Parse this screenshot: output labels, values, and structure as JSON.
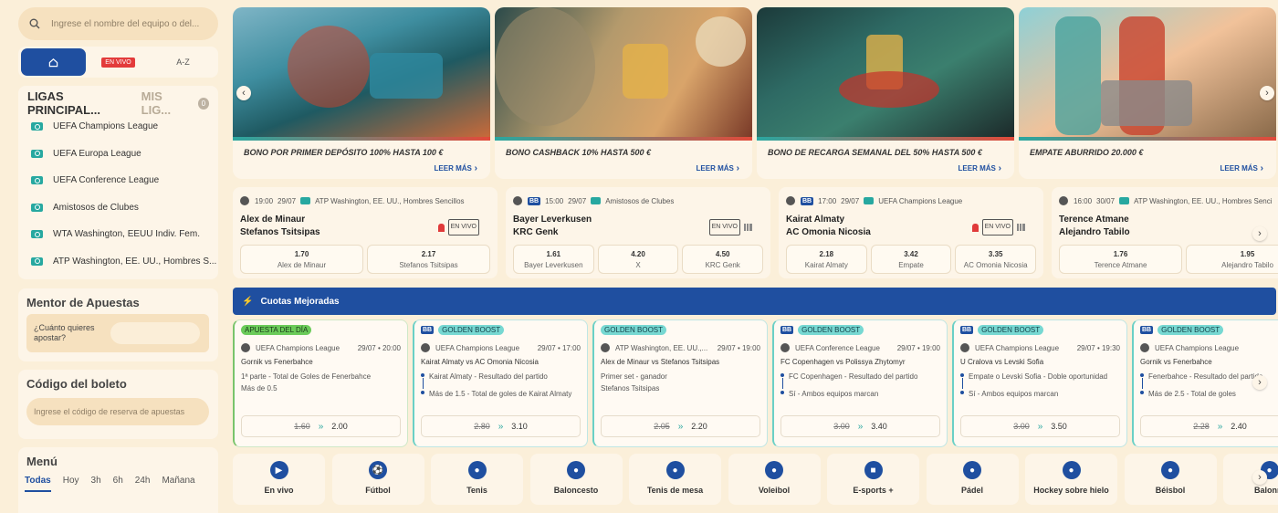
{
  "search": {
    "placeholder": "Ingrese el nombre del equipo o del..."
  },
  "nav": {
    "home_icon": "home-icon",
    "live_label": "EN VIVO",
    "az_label": "A-Z"
  },
  "leagues": {
    "title": "LIGAS PRINCIPAL...",
    "mine": "MIS LIG...",
    "mine_count": "0",
    "items": [
      "UEFA Champions League",
      "UEFA Europa League",
      "UEFA Conference League",
      "Amistosos de Clubes",
      "WTA Washington, EEUU Indiv. Fem.",
      "ATP Washington, EE. UU., Hombres S..."
    ]
  },
  "mentor": {
    "title": "Mentor de Apuestas",
    "question": "¿Cuánto quieres apostar?"
  },
  "ticket": {
    "title": "Código del boleto",
    "placeholder": "Ingrese el código de reserva de apuestas"
  },
  "menu": {
    "title": "Menú",
    "tabs": [
      "Todas",
      "Hoy",
      "3h",
      "6h",
      "24h",
      "Mañana"
    ]
  },
  "promos": [
    {
      "title": "BONO POR PRIMER DEPÓSITO 100% HASTA 100 €",
      "more": "LEER MÁS"
    },
    {
      "title": "BONO CASHBACK 10% HASTA 500 €",
      "more": "LEER MÁS"
    },
    {
      "title": "BONO DE RECARGA SEMANAL DEL 50% HASTA 500 €",
      "more": "LEER MÁS"
    },
    {
      "title": "EMPATE ABURRIDO 20.000 €",
      "more": "LEER MÁS"
    }
  ],
  "matches": [
    {
      "time": "19:00",
      "date": "29/07",
      "league": "ATP Washington, EE. UU., Hombres Sencillos",
      "team1": "Alex de Minaur",
      "team2": "Stefanos Tsitsipas",
      "live": "EN VIVO",
      "odds": [
        {
          "v": "1.70",
          "l": "Alex de Minaur"
        },
        {
          "v": "2.17",
          "l": "Stefanos Tsitsipas"
        }
      ]
    },
    {
      "bb": "BB",
      "time": "15:00",
      "date": "29/07",
      "league": "Amistosos de Clubes",
      "team1": "Bayer Leverkusen",
      "team2": "KRC Genk",
      "live": "EN VIVO",
      "odds": [
        {
          "v": "1.61",
          "l": "Bayer Leverkusen"
        },
        {
          "v": "4.20",
          "l": "X"
        },
        {
          "v": "4.50",
          "l": "KRC Genk"
        }
      ]
    },
    {
      "bb": "BB",
      "time": "17:00",
      "date": "29/07",
      "league": "UEFA Champions League",
      "team1": "Kairat Almaty",
      "team2": "AC Omonia Nicosia",
      "live": "EN VIVO",
      "odds": [
        {
          "v": "2.18",
          "l": "Kairat Almaty"
        },
        {
          "v": "3.42",
          "l": "Empate"
        },
        {
          "v": "3.35",
          "l": "AC Omonia Nicosia"
        }
      ]
    },
    {
      "time": "16:00",
      "date": "30/07",
      "league": "ATP Washington, EE. UU., Hombres Senci",
      "team1": "Terence Atmane",
      "team2": "Alejandro Tabilo",
      "odds": [
        {
          "v": "1.76",
          "l": "Terence Atmane"
        },
        {
          "v": "1.95",
          "l": "Alejandro Tabilo"
        }
      ]
    }
  ],
  "boost_title": "Cuotas Mejoradas",
  "boosts": [
    {
      "tag": "APUESTA DEL DÍA",
      "league": "UEFA Champions League",
      "date": "29/07 • 20:00",
      "match": "Gornik vs Fenerbahce",
      "lines": [
        "1ª parte - Total de Goles de Fenerbahce",
        "Más de 0.5"
      ],
      "old": "1.60",
      "new": "2.00"
    },
    {
      "bb": "BB",
      "tag": "GOLDEN BOOST",
      "league": "UEFA Champions League",
      "date": "29/07 • 17:00",
      "match": "Kairat Almaty vs AC Omonia Nicosia",
      "sels": [
        "Kairat Almaty - Resultado del partido",
        "Más de 1.5 - Total de goles de Kairat Almaty"
      ],
      "old": "2.80",
      "new": "3.10"
    },
    {
      "tag": "GOLDEN BOOST",
      "league": "ATP Washington, EE. UU.,...",
      "date": "29/07 • 19:00",
      "match": "Alex de Minaur vs Stefanos Tsitsipas",
      "lines": [
        "Primer set - ganador",
        "Stefanos Tsitsipas"
      ],
      "old": "2.05",
      "new": "2.20"
    },
    {
      "bb": "BB",
      "tag": "GOLDEN BOOST",
      "league": "UEFA Conference League",
      "date": "29/07 • 19:00",
      "match": "FC Copenhagen vs Polissya Zhytomyr",
      "sels": [
        "FC Copenhagen - Resultado del partido",
        "Sí - Ambos equipos marcan"
      ],
      "old": "3.00",
      "new": "3.40"
    },
    {
      "bb": "BB",
      "tag": "GOLDEN BOOST",
      "league": "UEFA Champions League",
      "date": "29/07 • 19:30",
      "match": "U Cralova vs Levski Sofia",
      "sels": [
        "Empate o Levski Sofia - Doble oportunidad",
        "Sí - Ambos equipos marcan"
      ],
      "old": "3.00",
      "new": "3.50"
    },
    {
      "bb": "BB",
      "tag": "GOLDEN BOOST",
      "league": "UEFA Champions League",
      "date": "29/07",
      "match": "Gornik vs Fenerbahce",
      "sels": [
        "Fenerbahce - Resultado del partido",
        "Más de 2.5 - Total de goles"
      ],
      "old": "2.28",
      "new": "2.40"
    }
  ],
  "sports": [
    {
      "label": "En vivo",
      "icon": "play-icon",
      "glyph": "▶"
    },
    {
      "label": "Fútbol",
      "icon": "soccer-ball-icon",
      "glyph": "⚽"
    },
    {
      "label": "Tenis",
      "icon": "tennis-ball-icon",
      "glyph": "●"
    },
    {
      "label": "Baloncesto",
      "icon": "basketball-icon",
      "glyph": "●"
    },
    {
      "label": "Tenis de mesa",
      "icon": "table-tennis-icon",
      "glyph": "●"
    },
    {
      "label": "Voleibol",
      "icon": "volleyball-icon",
      "glyph": "●"
    },
    {
      "label": "E-sports +",
      "icon": "gamepad-icon",
      "glyph": "■"
    },
    {
      "label": "Pádel",
      "icon": "padel-icon",
      "glyph": "●"
    },
    {
      "label": "Hockey sobre hielo",
      "icon": "hockey-icon",
      "glyph": "●"
    },
    {
      "label": "Béisbol",
      "icon": "baseball-icon",
      "glyph": "●"
    },
    {
      "label": "Balonm",
      "icon": "handball-icon",
      "glyph": "●"
    }
  ],
  "colors": {
    "primary": "#1f4fa0",
    "live": "#e33b3b",
    "teal": "#27a8a0",
    "background": "#fbefd9"
  }
}
